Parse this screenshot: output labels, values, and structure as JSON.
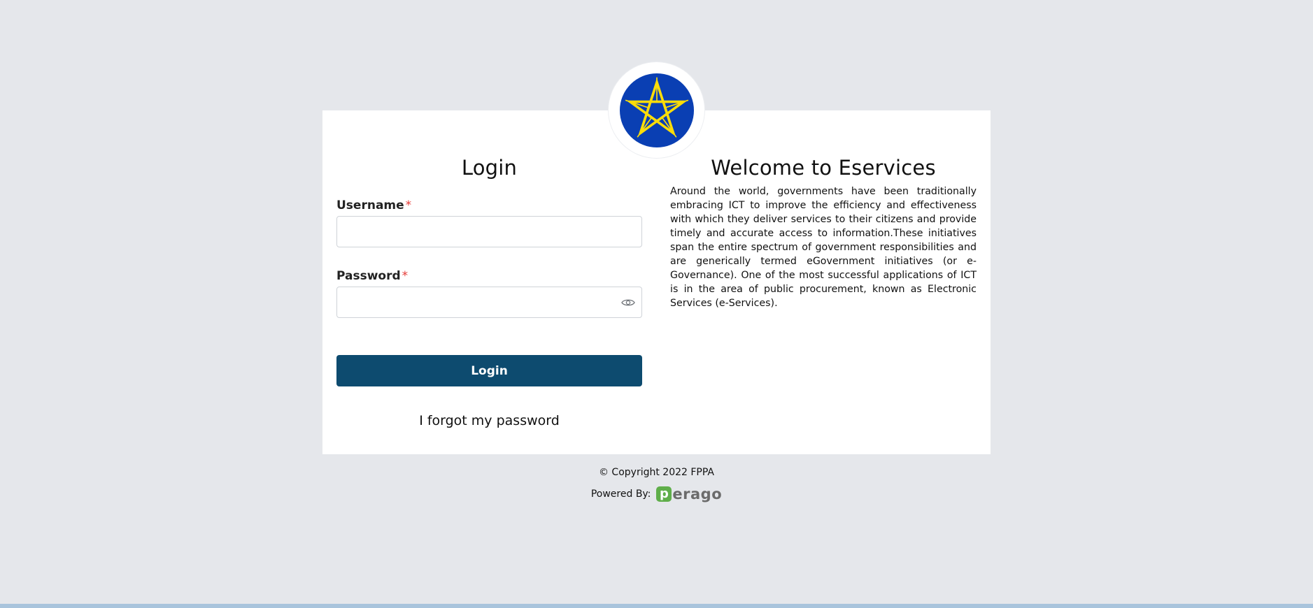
{
  "login": {
    "title": "Login",
    "username_label": "Username",
    "username_required": "*",
    "username_value": "",
    "password_label": "Password",
    "password_required": "*",
    "password_value": "",
    "submit_label": "Login",
    "forgot_label": "I forgot my password"
  },
  "welcome": {
    "title": "Welcome to Eservices",
    "text": "Around the world, governments have been traditionally embracing ICT to improve the efficiency and effectiveness with which they deliver services to their citizens and provide timely and accurate access to information.These initiatives span the entire spectrum of government responsibilities and are generically termed eGovernment initiatives (or e-Governance). One of the most successful applications of ICT is in the area of public procurement, known as Electronic Services (e-Services)."
  },
  "footer": {
    "copyright": "© Copyright 2022 FPPA",
    "powered_by": "Powered By:",
    "powered_logo_mark": "p",
    "powered_logo_text": "erago"
  },
  "icons": {
    "emblem": "ethiopian-emblem-icon",
    "password_toggle": "eye-icon"
  },
  "colors": {
    "background": "#e5e7eb",
    "card": "#ffffff",
    "primary_button": "#0d4b6f",
    "required_star": "#e53935",
    "emblem_blue": "#0a3fb3",
    "emblem_yellow": "#fcdd09",
    "perago_green": "#5fae4a"
  }
}
